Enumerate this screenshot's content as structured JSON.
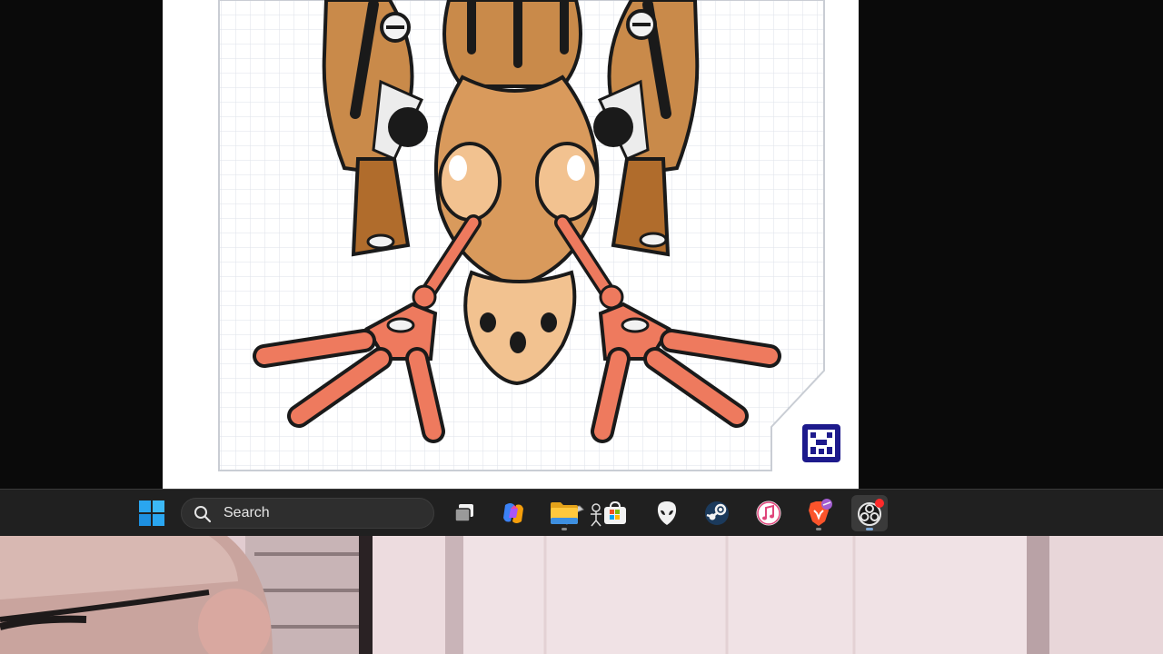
{
  "taskbar": {
    "search": {
      "label": "Search"
    },
    "items": [
      {
        "name": "windows-start",
        "icon": "windows-logo-icon"
      },
      {
        "name": "task-view",
        "icon": "task-view-icon"
      },
      {
        "name": "copilot",
        "icon": "copilot-icon"
      },
      {
        "name": "file-explorer",
        "icon": "folder-icon"
      },
      {
        "name": "microsoft-store",
        "icon": "store-icon"
      },
      {
        "name": "alienware",
        "icon": "alien-head-icon"
      },
      {
        "name": "steam",
        "icon": "steam-icon"
      },
      {
        "name": "itunes",
        "icon": "music-note-icon"
      },
      {
        "name": "brave",
        "icon": "brave-lion-icon"
      },
      {
        "name": "obs-studio",
        "icon": "obs-icon",
        "active": true,
        "badge_color": "#ff2a2a"
      }
    ]
  },
  "colors": {
    "taskbar_bg": "#202020",
    "robot_body": "#c98a4a",
    "robot_highlight": "#f2c290",
    "robot_hands": "#ee7a5e",
    "logo_blue": "#1d1a8c"
  }
}
